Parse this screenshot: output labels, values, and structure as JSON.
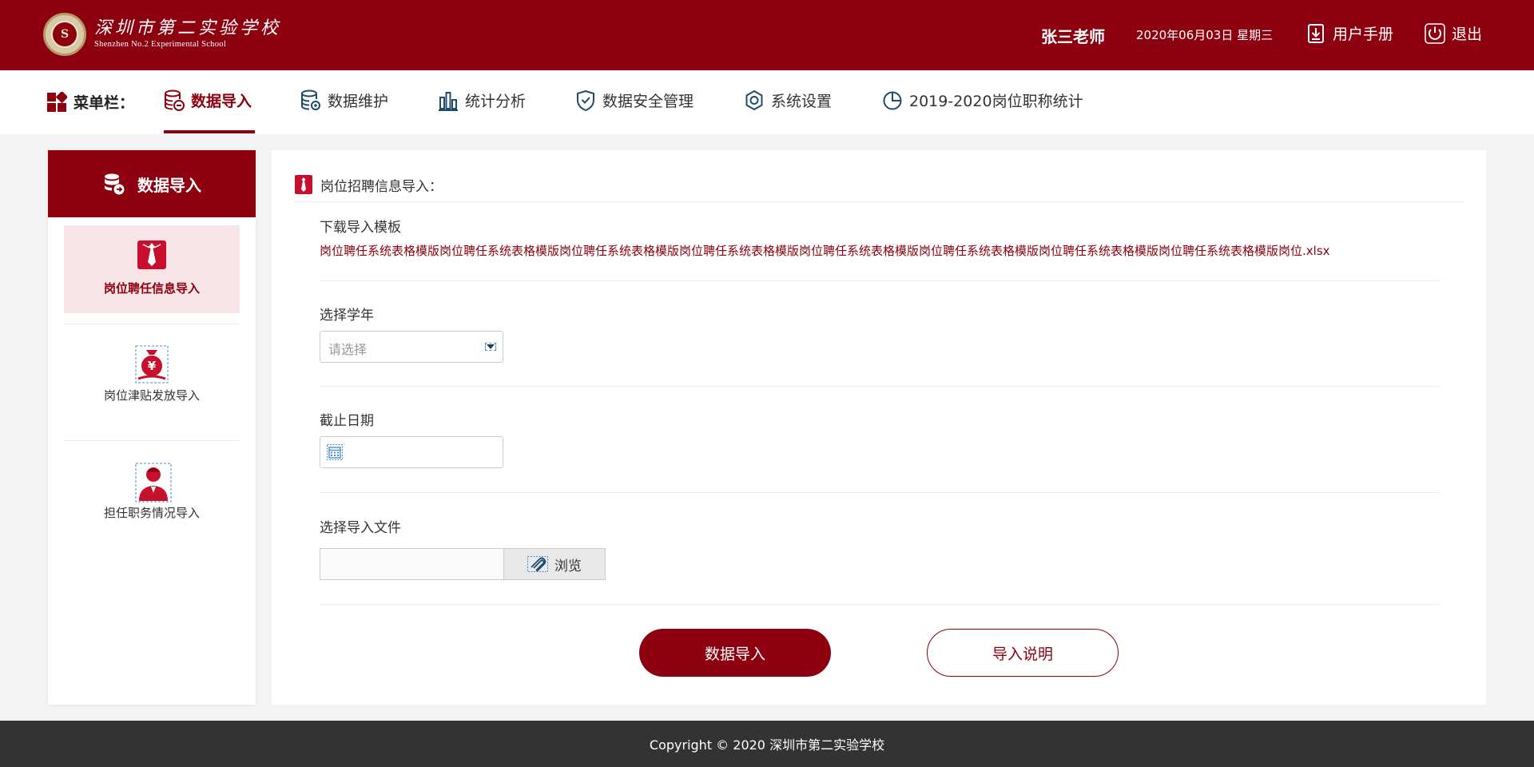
{
  "header": {
    "school_cn": "深圳市第二实验学校",
    "school_en": "Shenzhen No.2 Experimental School",
    "user": "张三老师",
    "date": "2020年06月03日 星期三",
    "manual_label": "用户手册",
    "logout_label": "退出"
  },
  "menu": {
    "label": "菜单栏：",
    "items": [
      {
        "label": "数据导入",
        "icon": "database-import-icon"
      },
      {
        "label": "数据维护",
        "icon": "database-settings-icon"
      },
      {
        "label": "统计分析",
        "icon": "bar-chart-icon"
      },
      {
        "label": "数据安全管理",
        "icon": "shield-icon"
      },
      {
        "label": "系统设置",
        "icon": "gear-icon"
      },
      {
        "label": "2019-2020岗位职称统计",
        "icon": "pie-chart-icon"
      }
    ]
  },
  "sidebar": {
    "title": "数据导入",
    "items": [
      {
        "label": "岗位聘任信息导入",
        "icon": "tie-icon"
      },
      {
        "label": "岗位津贴发放导入",
        "icon": "money-bag-icon"
      },
      {
        "label": "担任职务情况导入",
        "icon": "person-icon"
      }
    ]
  },
  "main": {
    "section_title": "岗位招聘信息导入：",
    "download_label": "下载导入模板",
    "template_link": "岗位聘任系统表格模版岗位聘任系统表格模版岗位聘任系统表格模版岗位聘任系统表格模版岗位聘任系统表格模版岗位聘任系统表格模版岗位聘任系统表格模版岗位聘任系统表格模版岗位.xlsx",
    "year_label": "选择学年",
    "year_placeholder": "请选择",
    "deadline_label": "截止日期",
    "file_label": "选择导入文件",
    "browse_label": "浏览",
    "import_button": "数据导入",
    "help_button": "导入说明"
  },
  "footer": {
    "copyright": "Copyright © 2020 深圳市第二实验学校"
  },
  "colors": {
    "brand": "#8c0010",
    "footer_bg": "#333333",
    "active_bg": "#f6e4e6"
  }
}
